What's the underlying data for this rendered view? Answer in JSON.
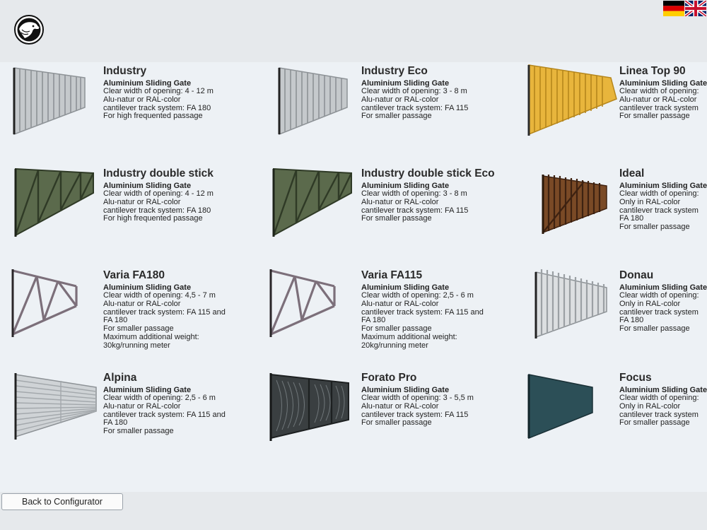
{
  "header": {
    "logo": "eagle-logo",
    "flags": [
      {
        "language": "German",
        "icon": "german-flag-icon"
      },
      {
        "language": "English",
        "icon": "uk-flag-icon"
      }
    ]
  },
  "gates": [
    {
      "title": "Industry",
      "subtitle": "Aluminium Sliding Gate",
      "lines": [
        "Clear width of opening: 4 - 12 m",
        "Alu-natur or RAL-color",
        "cantilever track system: FA 180",
        "For high frequented passage"
      ],
      "color": "#b8bcc0"
    },
    {
      "title": "Industry Eco",
      "subtitle": "Aluminium Sliding Gate",
      "lines": [
        "Clear width of opening: 3 - 8 m",
        "Alu-natur or RAL-color",
        "cantilever track system: FA 115",
        "For smaller passage"
      ],
      "color": "#b8bcc0"
    },
    {
      "title": "Linea Top 90",
      "subtitle": "Aluminium Sliding Gate",
      "lines": [
        "Clear width of opening:",
        "Alu-natur or RAL-color",
        "cantilever track system",
        "For smaller passage"
      ],
      "color": "#e7b43a"
    },
    {
      "title": "Industry double stick",
      "subtitle": "Aluminium Sliding Gate",
      "lines": [
        "Clear width of opening: 4 - 12 m",
        "Alu-natur or RAL-color",
        "cantilever track system: FA 180",
        "For high frequented passage"
      ],
      "color": "#3d4a33"
    },
    {
      "title": "Industry double stick Eco",
      "subtitle": "Aluminium Sliding Gate",
      "lines": [
        "Clear width of opening: 3 - 8 m",
        "Alu-natur or RAL-color",
        "cantilever track system: FA 115",
        "For smaller passage"
      ],
      "color": "#3d4a33"
    },
    {
      "title": "Ideal",
      "subtitle": "Aluminium Sliding Gate",
      "lines": [
        "Clear width of opening:",
        "Only in RAL-color",
        "cantilever track system",
        "FA 180",
        "For smaller passage"
      ],
      "color": "#5a3318"
    },
    {
      "title": "Varia FA180",
      "subtitle": "Aluminium Sliding Gate",
      "lines": [
        "Clear width of opening: 4,5 - 7 m",
        "Alu-natur or RAL-color",
        "cantilever track system: FA 115 and",
        "FA 180",
        "For smaller passage",
        "Maximum additional weight:",
        "30kg/running meter"
      ],
      "color": "#7a6d78"
    },
    {
      "title": "Varia FA115",
      "subtitle": "Aluminium Sliding Gate",
      "lines": [
        "Clear width of opening: 2,5 - 6 m",
        "Alu-natur or RAL-color",
        "cantilever track system: FA 115 and",
        "FA 180",
        "For smaller passage",
        "Maximum additional weight:",
        "20kg/running meter"
      ],
      "color": "#7a6d78"
    },
    {
      "title": "Donau",
      "subtitle": "Aluminium Sliding Gate",
      "lines": [
        "Clear width of opening:",
        "Only in RAL-color",
        "cantilever track system",
        "FA 180",
        "For smaller passage"
      ],
      "color": "#b8bcc0"
    },
    {
      "title": "Alpina",
      "subtitle": "Aluminium Sliding Gate",
      "lines": [
        "Clear width of opening: 2,5 - 6 m",
        "Alu-natur or RAL-color",
        "cantilever track system: FA 115 and",
        "FA 180",
        "For smaller passage"
      ],
      "color": "#b8bcc0"
    },
    {
      "title": "Forato Pro",
      "subtitle": "Aluminium Sliding Gate",
      "lines": [
        "Clear width of opening: 3 - 5,5 m",
        "Alu-natur or RAL-color",
        "cantilever track system: FA 115",
        "For smaller passage"
      ],
      "color": "#34393b"
    },
    {
      "title": "Focus",
      "subtitle": "Aluminium Sliding Gate",
      "lines": [
        "Clear width of opening:",
        "Only in RAL-color",
        "cantilever track system",
        "For smaller passage"
      ],
      "color": "#2c4f57"
    }
  ],
  "footer": {
    "back_label": "Back to Configurator"
  }
}
